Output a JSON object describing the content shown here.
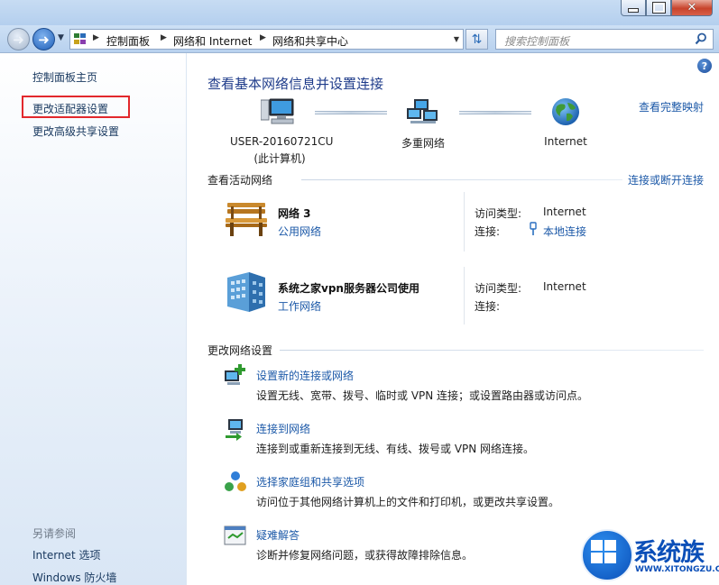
{
  "window": {
    "controls": {
      "minimize": "–",
      "maximize": "□",
      "close": "✕"
    }
  },
  "nav": {
    "back_icon": "back-arrow-icon",
    "forward_icon": "forward-arrow-icon",
    "breadcrumb": [
      "控制面板",
      "网络和 Internet",
      "网络和共享中心"
    ],
    "search_placeholder": "搜索控制面板"
  },
  "sidebar": {
    "items": [
      {
        "label": "控制面板主页"
      },
      {
        "label": "更改适配器设置",
        "highlighted": true
      },
      {
        "label": "更改高级共享设置"
      }
    ],
    "see_also_heading": "另请参阅",
    "see_also": [
      {
        "label": "Internet 选项"
      },
      {
        "label": "Windows 防火墙"
      }
    ]
  },
  "main": {
    "title": "查看基本网络信息并设置连接",
    "view_full_map": "查看完整映射",
    "map_nodes": [
      {
        "label": "USER-20160721CU",
        "sublabel": "(此计算机)",
        "icon": "computer-icon"
      },
      {
        "label": "多重网络",
        "icon": "multiple-networks-icon"
      },
      {
        "label": "Internet",
        "icon": "globe-icon"
      }
    ],
    "active_networks_heading": "查看活动网络",
    "connect_disconnect": "连接或断开连接",
    "networks": [
      {
        "name": "网络  3",
        "type": "公用网络",
        "icon": "park-bench-icon",
        "access_type_label": "访问类型:",
        "access_type_value": "Internet",
        "connections_label": "连接:",
        "connections_value": "本地连接"
      },
      {
        "name": "系统之家vpn服务器公司使用",
        "type": "工作网络",
        "icon": "office-building-icon",
        "access_type_label": "访问类型:",
        "access_type_value": "Internet",
        "connections_label": "连接:",
        "connections_value": ""
      }
    ],
    "change_settings_heading": "更改网络设置",
    "tasks": [
      {
        "title": "设置新的连接或网络",
        "desc": "设置无线、宽带、拨号、临时或 VPN 连接；或设置路由器或访问点。",
        "icon": "new-connection-icon"
      },
      {
        "title": "连接到网络",
        "desc": "连接到或重新连接到无线、有线、拨号或 VPN 网络连接。",
        "icon": "connect-network-icon"
      },
      {
        "title": "选择家庭组和共享选项",
        "desc": "访问位于其他网络计算机上的文件和打印机，或更改共享设置。",
        "icon": "homegroup-icon"
      },
      {
        "title": "疑难解答",
        "desc": "诊断并修复网络问题，或获得故障排除信息。",
        "icon": "troubleshoot-icon"
      }
    ]
  },
  "watermark": {
    "brand": "系统族",
    "url": "WWW.XITONGZU.COM"
  }
}
